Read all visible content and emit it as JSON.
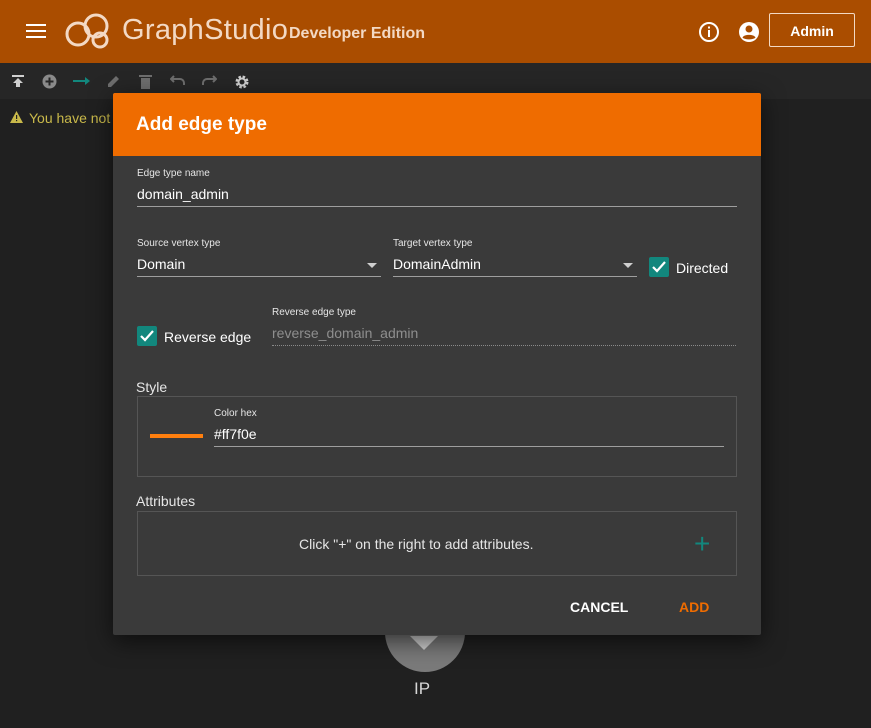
{
  "header": {
    "brand": "GraphStudio",
    "edition": "Developer Edition",
    "admin_label": "Admin"
  },
  "icons": [
    "menu-icon",
    "graphstudio-logo",
    "info-icon",
    "account-icon",
    "publish-icon",
    "add-icon",
    "edge-icon",
    "edit-icon",
    "delete-icon",
    "undo-icon",
    "redo-icon",
    "settings-icon",
    "warning-icon",
    "check-icon",
    "plus-icon"
  ],
  "warning": {
    "text": "You have not"
  },
  "vertex": {
    "label": "IP"
  },
  "dialog": {
    "title": "Add edge type",
    "edge_name": {
      "label": "Edge type name",
      "value": "domain_admin"
    },
    "source": {
      "label": "Source vertex type",
      "value": "Domain"
    },
    "target": {
      "label": "Target vertex type",
      "value": "DomainAdmin"
    },
    "directed": {
      "label": "Directed",
      "checked": true
    },
    "reverse": {
      "label": "Reverse edge",
      "checked": true
    },
    "reverse_type": {
      "label": "Reverse edge type",
      "value": "reverse_domain_admin"
    },
    "style": {
      "title": "Style",
      "color_label": "Color hex",
      "color_value": "#ff7f0e"
    },
    "attributes": {
      "title": "Attributes",
      "hint": "Click \"+\" on the right to add attributes."
    },
    "cancel_label": "CANCEL",
    "add_label": "ADD"
  },
  "colors": {
    "header": "#aa4d00",
    "accent": "#ef6c00",
    "teal": "#12877d",
    "edge_color": "#ff7f0e"
  }
}
